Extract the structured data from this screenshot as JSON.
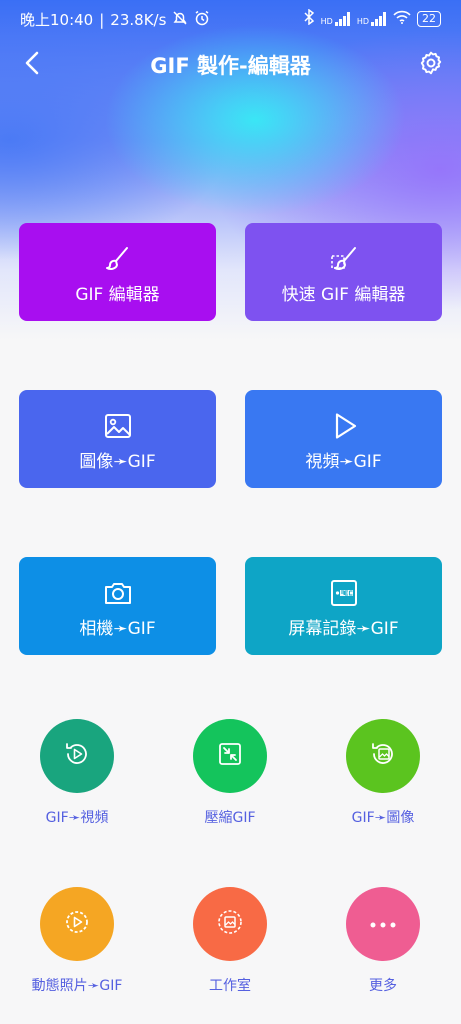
{
  "status_bar": {
    "time": "晚上10:40",
    "network_speed": "23.8K/s",
    "battery": "22",
    "signal_label_1": "HD",
    "signal_label_2": "HD"
  },
  "header": {
    "title": "GIF 製作-編輯器",
    "back_icon": "chevron-left-icon",
    "settings_icon": "gear-icon"
  },
  "cards": [
    {
      "label": "GIF 編輯器",
      "icon": "brush-icon",
      "color": "#a80ef0"
    },
    {
      "label": "快速 GIF 編輯器",
      "icon": "fast-brush-icon",
      "color": "#7e52f0"
    },
    {
      "label": "圖像➛GIF",
      "icon": "image-icon",
      "color": "#4a66ee"
    },
    {
      "label": "視頻➛GIF",
      "icon": "play-icon",
      "color": "#3978f2"
    },
    {
      "label": "相機➛GIF",
      "icon": "camera-icon",
      "color": "#0d8fe6"
    },
    {
      "label": "屏幕記錄➛GIF",
      "icon": "rec-icon",
      "color": "#0ea5c6"
    }
  ],
  "tools": [
    {
      "label": "GIF➛視頻",
      "icon": "video-convert-icon",
      "color": "#19a57e"
    },
    {
      "label": "壓縮GIF",
      "icon": "compress-icon",
      "color": "#14c45c"
    },
    {
      "label": "GIF➛圖像",
      "icon": "image-convert-icon",
      "color": "#5bc41f"
    },
    {
      "label": "動態照片➛GIF",
      "icon": "live-photo-icon",
      "color": "#f5a623"
    },
    {
      "label": "工作室",
      "icon": "studio-icon",
      "color": "#f86a45"
    },
    {
      "label": "更多",
      "icon": "more-icon",
      "color": "#ef5d92"
    }
  ]
}
